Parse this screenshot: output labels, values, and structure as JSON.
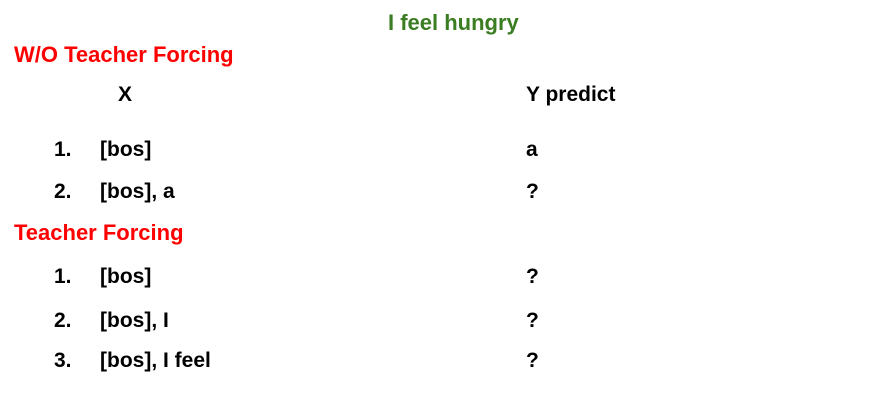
{
  "title": "I feel hungry",
  "colors": {
    "title": "#3a7d22",
    "section": "#ff0000",
    "text": "#000000"
  },
  "headers": {
    "x": "X",
    "y": "Y predict"
  },
  "sections": [
    {
      "label": "W/O Teacher Forcing",
      "rows": [
        {
          "num": "1.",
          "x": "[bos]",
          "y": "a"
        },
        {
          "num": "2.",
          "x": "[bos], a",
          "y": "?"
        }
      ]
    },
    {
      "label": "Teacher Forcing",
      "rows": [
        {
          "num": "1.",
          "x": "[bos]",
          "y": "?"
        },
        {
          "num": "2.",
          "x": "[bos], I",
          "y": "?"
        },
        {
          "num": "3.",
          "x": "[bos], I feel",
          "y": "?"
        }
      ]
    }
  ]
}
